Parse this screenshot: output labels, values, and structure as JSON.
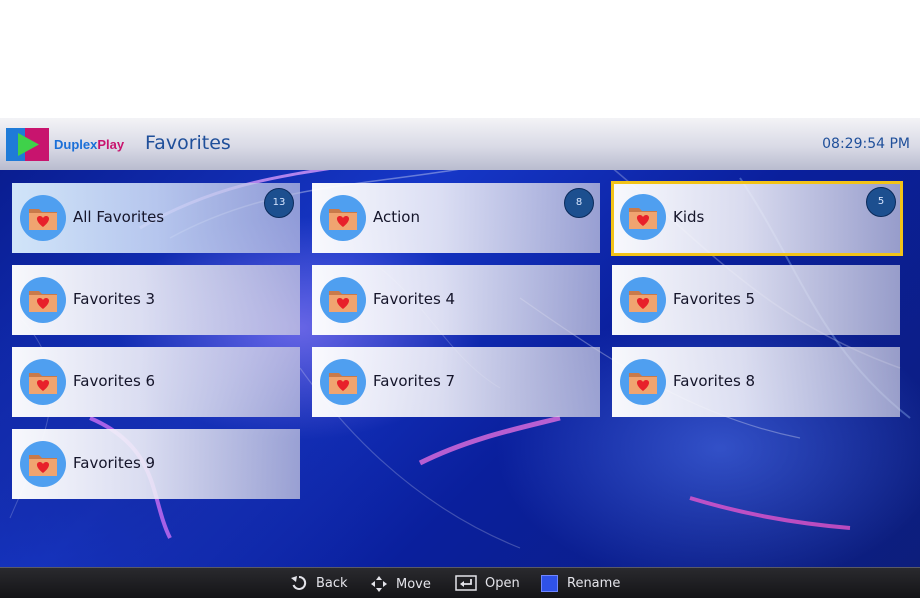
{
  "header": {
    "logo_part1": "Duplex",
    "logo_part2": "Play",
    "title": "Favorites",
    "clock": "08:29:54 PM"
  },
  "tiles": [
    {
      "label": "All Favorites",
      "count": "13"
    },
    {
      "label": "Action",
      "count": "8"
    },
    {
      "label": "Kids",
      "count": "5"
    },
    {
      "label": "Favorites 3"
    },
    {
      "label": "Favorites 4"
    },
    {
      "label": "Favorites 5"
    },
    {
      "label": "Favorites 6"
    },
    {
      "label": "Favorites 7"
    },
    {
      "label": "Favorites 8"
    },
    {
      "label": "Favorites 9"
    }
  ],
  "focused_tile": "Kids",
  "footer": {
    "back": "Back",
    "move": "Move",
    "open": "Open",
    "rename": "Rename"
  },
  "icons": {
    "tile": "heart-folder-icon",
    "back": "back-arrow-icon",
    "move": "dpad-arrows-icon",
    "open": "enter-icon",
    "rename": "blue-button-icon"
  },
  "colors": {
    "accent_focus": "#f2c318",
    "icon_circle": "#4f9ff0",
    "rename_button": "#2f52e8",
    "title_text": "#1f4f9a"
  }
}
